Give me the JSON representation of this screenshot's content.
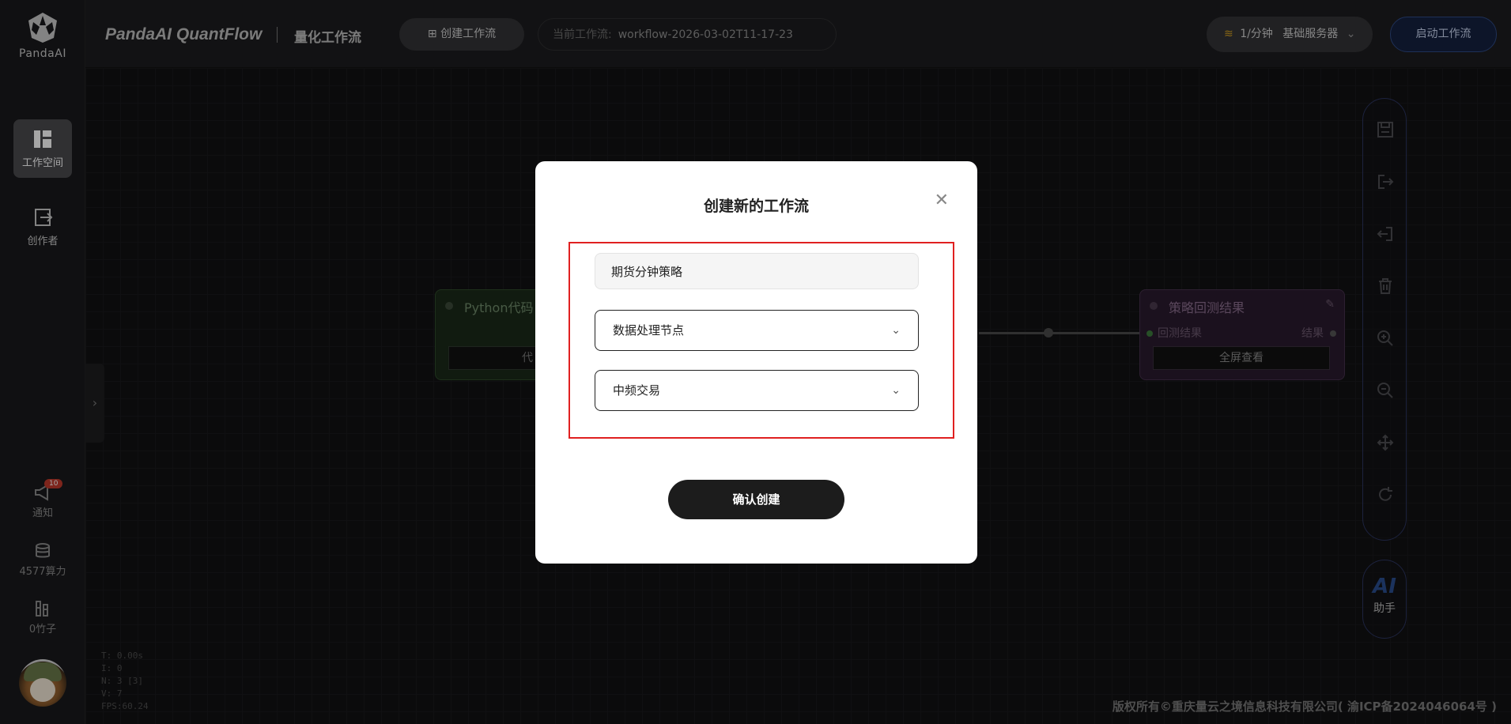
{
  "sidebar": {
    "logo_text": "PandaAI",
    "nav": [
      {
        "label": "工作空间",
        "active": true
      },
      {
        "label": "创作者",
        "active": false
      }
    ],
    "notifications": {
      "label": "通知",
      "badge": "10"
    },
    "compute": {
      "label": "4577算力"
    },
    "bamboo": {
      "label": "0竹子"
    }
  },
  "header": {
    "brand": "PandaAI QuantFlow",
    "subtitle": "量化工作流",
    "create_button": "创建工作流",
    "current_label": "当前工作流:",
    "current_value": "workflow-2026-03-02T11-17-23",
    "server_rate": "1/分钟",
    "server_name": "基础服务器",
    "start_button": "启动工作流"
  },
  "canvas": {
    "node_python": {
      "title": "Python代码",
      "button": "代"
    },
    "node_result": {
      "title": "策略回测结果",
      "input_port": "回测结果",
      "output_port": "结果",
      "button": "全屏查看"
    },
    "debug": [
      "T: 0.00s",
      "I: 0",
      "N: 3 [3]",
      "V: 7",
      "FPS:60.24"
    ],
    "footer": "版权所有©重庆量云之境信息科技有限公司( 渝ICP备2024046064号 )"
  },
  "right_toolbar": {
    "tools": [
      "save-icon",
      "export-icon",
      "import-icon",
      "delete-icon",
      "zoom-in-icon",
      "zoom-out-icon",
      "fit-icon",
      "reset-icon"
    ],
    "ai_label": "AI",
    "ai_sub": "助手"
  },
  "modal": {
    "title": "创建新的工作流",
    "name_value": "期货分钟策略",
    "select_node_type": "数据处理节点",
    "select_trade_type": "中频交易",
    "confirm_button": "确认创建"
  },
  "colors": {
    "accent": "#e02020",
    "dark_button": "#1c1c1c",
    "start_button": "#14213f"
  }
}
